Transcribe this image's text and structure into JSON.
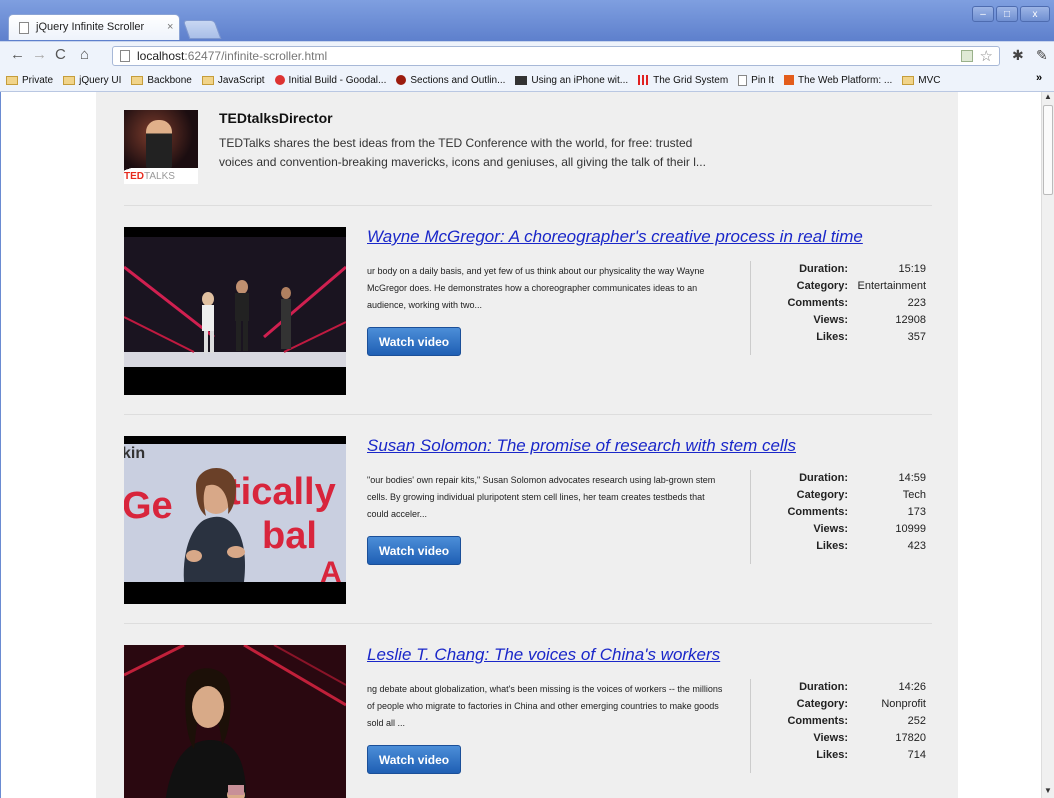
{
  "browser": {
    "tab_title": "jQuery Infinite Scroller",
    "tab_close": "×",
    "url_host": "localhost",
    "url_path": ":62477/infinite-scroller.html",
    "window_buttons": [
      "–",
      "□",
      "x"
    ]
  },
  "bookmarks": [
    {
      "label": "Private",
      "icon": "folder"
    },
    {
      "label": "jQuery UI",
      "icon": "folder"
    },
    {
      "label": "Backbone",
      "icon": "folder"
    },
    {
      "label": "JavaScript",
      "icon": "folder"
    },
    {
      "label": "Initial Build - Goodal...",
      "icon": "red"
    },
    {
      "label": "Sections and Outlin...",
      "icon": "darkred"
    },
    {
      "label": "Using an iPhone wit...",
      "icon": "dark"
    },
    {
      "label": "The Grid System",
      "icon": "grid"
    },
    {
      "label": "Pin It",
      "icon": "page"
    },
    {
      "label": "The Web Platform: ...",
      "icon": "square"
    },
    {
      "label": "MVC",
      "icon": "folder"
    }
  ],
  "bookmarks_more": "»",
  "profile": {
    "name": "TEDtalksDirector",
    "description": "TEDTalks shares the best ideas from the TED Conference with the world, for free: trusted voices and convention-breaking mavericks, icons and geniuses, all giving the talk of their l...",
    "logo_ted": "TED",
    "logo_talks": "TALKS"
  },
  "stat_labels": {
    "duration": "Duration:",
    "category": "Category:",
    "comments": "Comments:",
    "views": "Views:",
    "likes": "Likes:"
  },
  "watch_label": "Watch video",
  "talks": [
    {
      "title": "Wayne McGregor: A choreographer's creative process in real time",
      "summary": "ur body on a daily basis, and yet few of us think about our physicality the way Wayne McGregor does. He demonstrates how a choreographer communicates ideas to an audience, working with two...",
      "duration": "15:19",
      "category": "Entertainment",
      "comments": "223",
      "views": "12908",
      "likes": "357"
    },
    {
      "title": "Susan Solomon: The promise of research with stem cells",
      "summary": "\"our bodies' own repair kits,\" Susan Solomon advocates research using lab-grown stem cells. By growing individual pluripotent stem cell lines, her team creates testbeds that could acceler...",
      "duration": "14:59",
      "category": "Tech",
      "comments": "173",
      "views": "10999",
      "likes": "423"
    },
    {
      "title": "Leslie T. Chang: The voices of China's workers",
      "summary": "ng debate about globalization, what's been missing is the voices of workers -- the millions of people who migrate to factories in China and other emerging countries to make goods sold all ...",
      "duration": "14:26",
      "category": "Nonprofit",
      "comments": "252",
      "views": "17820",
      "likes": "714"
    }
  ],
  "thumb_text": {
    "t2_lines": [
      "kin",
      "Ge",
      "tically",
      "bal",
      "A"
    ]
  }
}
